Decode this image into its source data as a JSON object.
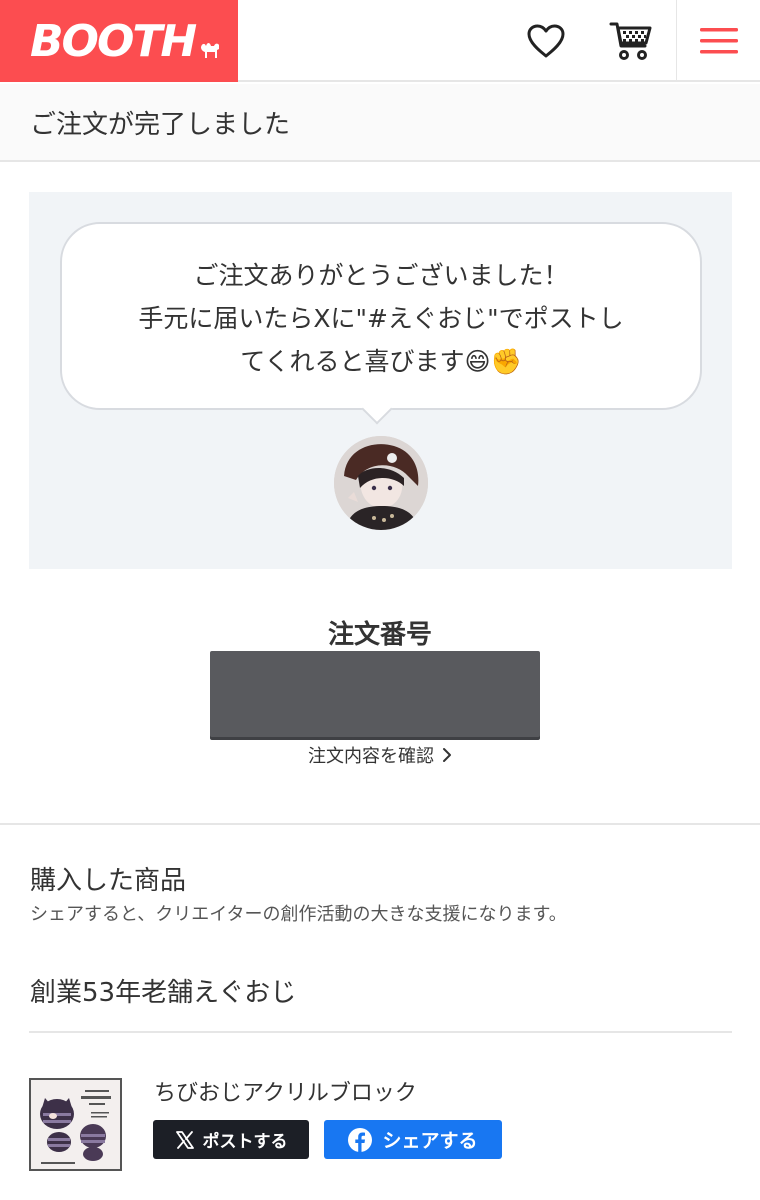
{
  "header": {
    "logo": "BOOTH",
    "brand_color": "#fc4d50",
    "icons": [
      "heart-icon",
      "cart-icon",
      "hamburger-menu-icon"
    ]
  },
  "page": {
    "title": "ご注文が完了しました"
  },
  "message": {
    "line1": "ご注文ありがとうございました！",
    "line2": "手元に届いたらXに\"#えぐおじ\"でポストし",
    "line3": "てくれると喜びます😄✊"
  },
  "order": {
    "label": "注文番号",
    "details_link": "注文内容を確認"
  },
  "purchased": {
    "title": "購入した商品",
    "subtitle": "シェアすると、クリエイターの創作活動の大きな支援になります。",
    "shop_name": "創業53年老舗えぐおじ",
    "items": [
      {
        "name": "ちびおじアクリルブロック",
        "post_label": "ポストする",
        "share_label": "シェアする"
      }
    ]
  }
}
